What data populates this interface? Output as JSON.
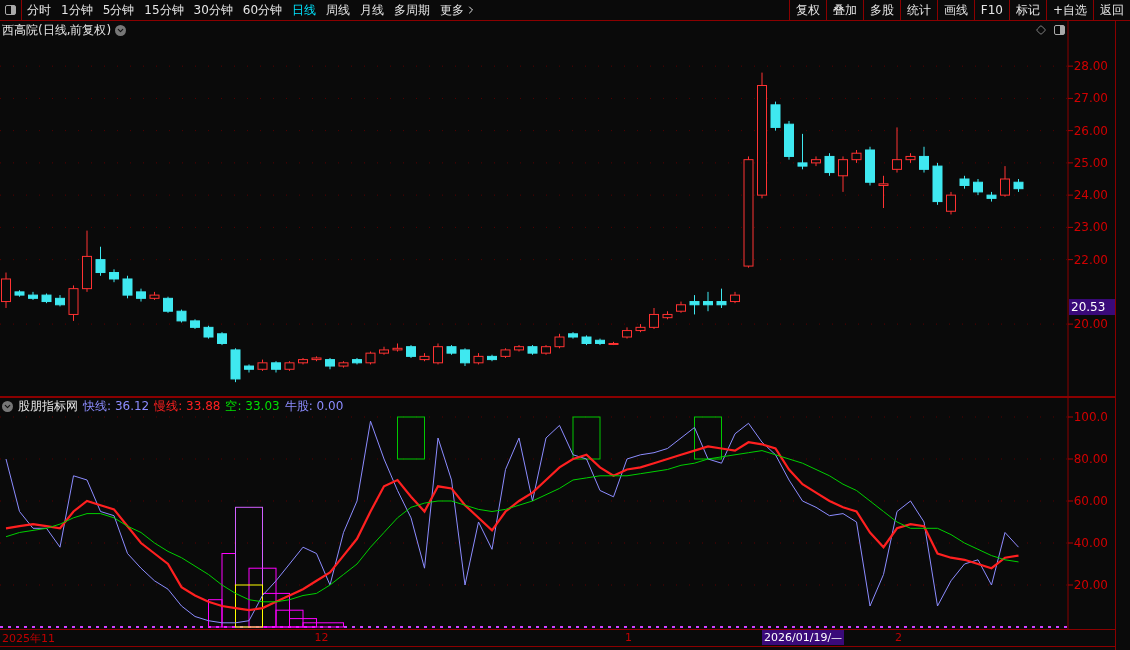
{
  "toolbar": {
    "periods": [
      {
        "label": "分时",
        "selected": false
      },
      {
        "label": "1分钟",
        "selected": false
      },
      {
        "label": "5分钟",
        "selected": false
      },
      {
        "label": "15分钟",
        "selected": false
      },
      {
        "label": "30分钟",
        "selected": false
      },
      {
        "label": "60分钟",
        "selected": false
      },
      {
        "label": "日线",
        "selected": true
      },
      {
        "label": "周线",
        "selected": false
      },
      {
        "label": "月线",
        "selected": false
      },
      {
        "label": "多周期",
        "selected": false
      },
      {
        "label": "更多",
        "selected": false
      }
    ],
    "actions": [
      "复权",
      "叠加",
      "多股",
      "统计",
      "画线",
      "F10",
      "标记",
      "+自选",
      "返回"
    ]
  },
  "price_panel": {
    "title": "西高院(日线,前复权)",
    "last_price": "20.53",
    "chart_data": {
      "type": "candlestick",
      "grid": true,
      "ylim": [
        17.74,
        29.4
      ],
      "yticks": [
        {
          "value": 28,
          "label": "28.00"
        },
        {
          "value": 27,
          "label": "27.00"
        },
        {
          "value": 26,
          "label": "26.00"
        },
        {
          "value": 25,
          "label": "25.00"
        },
        {
          "value": 24,
          "label": "24.00"
        },
        {
          "value": 23,
          "label": "23.00"
        },
        {
          "value": 22,
          "label": "22.00"
        },
        {
          "value": 20,
          "label": "20.00"
        }
      ],
      "ohlc": [
        [
          20.7,
          21.6,
          20.5,
          21.4
        ],
        [
          21.0,
          21.05,
          20.85,
          20.9
        ],
        [
          20.9,
          21.0,
          20.75,
          20.8
        ],
        [
          20.9,
          20.95,
          20.65,
          20.7
        ],
        [
          20.8,
          20.9,
          20.55,
          20.6
        ],
        [
          20.3,
          21.2,
          20.1,
          21.1
        ],
        [
          21.1,
          22.9,
          21.0,
          22.1
        ],
        [
          22.0,
          22.4,
          21.5,
          21.6
        ],
        [
          21.6,
          21.7,
          21.3,
          21.4
        ],
        [
          21.4,
          21.5,
          20.8,
          20.9
        ],
        [
          21.0,
          21.1,
          20.7,
          20.8
        ],
        [
          20.8,
          21.0,
          20.75,
          20.9
        ],
        [
          20.8,
          20.85,
          20.35,
          20.4
        ],
        [
          20.4,
          20.45,
          20.05,
          20.1
        ],
        [
          20.1,
          20.15,
          19.85,
          19.9
        ],
        [
          19.9,
          19.95,
          19.55,
          19.6
        ],
        [
          19.7,
          19.75,
          19.35,
          19.4
        ],
        [
          19.2,
          19.25,
          18.2,
          18.3
        ],
        [
          18.7,
          18.75,
          18.5,
          18.6
        ],
        [
          18.6,
          18.9,
          18.55,
          18.8
        ],
        [
          18.8,
          18.85,
          18.5,
          18.6
        ],
        [
          18.6,
          18.85,
          18.55,
          18.8
        ],
        [
          18.8,
          18.95,
          18.75,
          18.9
        ],
        [
          18.9,
          19.0,
          18.85,
          18.95
        ],
        [
          18.9,
          18.95,
          18.6,
          18.7
        ],
        [
          18.7,
          18.85,
          18.65,
          18.8
        ],
        [
          18.9,
          18.95,
          18.75,
          18.8
        ],
        [
          18.8,
          19.15,
          18.75,
          19.1
        ],
        [
          19.1,
          19.3,
          19.05,
          19.2
        ],
        [
          19.2,
          19.4,
          19.15,
          19.25
        ],
        [
          19.3,
          19.35,
          18.95,
          19.0
        ],
        [
          18.9,
          19.1,
          18.85,
          19.0
        ],
        [
          18.8,
          19.4,
          18.75,
          19.3
        ],
        [
          19.3,
          19.35,
          19.05,
          19.1
        ],
        [
          19.2,
          19.25,
          18.7,
          18.8
        ],
        [
          18.8,
          19.1,
          18.75,
          19.0
        ],
        [
          19.0,
          19.05,
          18.85,
          18.9
        ],
        [
          19.0,
          19.25,
          18.95,
          19.2
        ],
        [
          19.2,
          19.35,
          19.15,
          19.3
        ],
        [
          19.3,
          19.35,
          19.05,
          19.1
        ],
        [
          19.1,
          19.35,
          19.05,
          19.3
        ],
        [
          19.3,
          19.7,
          19.25,
          19.6
        ],
        [
          19.7,
          19.75,
          19.55,
          19.6
        ],
        [
          19.6,
          19.65,
          19.35,
          19.4
        ],
        [
          19.5,
          19.55,
          19.35,
          19.4
        ],
        [
          19.4,
          19.45,
          19.35,
          19.4
        ],
        [
          19.6,
          19.9,
          19.55,
          19.8
        ],
        [
          19.8,
          20.0,
          19.75,
          19.9
        ],
        [
          19.9,
          20.5,
          19.85,
          20.3
        ],
        [
          20.2,
          20.4,
          20.15,
          20.3
        ],
        [
          20.4,
          20.7,
          20.35,
          20.6
        ],
        [
          20.7,
          20.9,
          20.3,
          20.6
        ],
        [
          20.7,
          21.0,
          20.4,
          20.6
        ],
        [
          20.7,
          21.1,
          20.5,
          20.6
        ],
        [
          20.7,
          21.0,
          20.65,
          20.9
        ],
        [
          21.8,
          25.2,
          21.75,
          25.1
        ],
        [
          24.0,
          27.8,
          23.9,
          27.4
        ],
        [
          26.8,
          26.9,
          26.0,
          26.1
        ],
        [
          26.2,
          26.3,
          25.1,
          25.2
        ],
        [
          25.0,
          25.9,
          24.8,
          24.9
        ],
        [
          25.0,
          25.2,
          24.9,
          25.1
        ],
        [
          25.2,
          25.3,
          24.6,
          24.7
        ],
        [
          24.6,
          25.2,
          24.1,
          25.1
        ],
        [
          25.1,
          25.4,
          25.0,
          25.3
        ],
        [
          25.4,
          25.5,
          24.3,
          24.4
        ],
        [
          24.3,
          24.6,
          23.6,
          24.35
        ],
        [
          24.8,
          26.1,
          24.7,
          25.1
        ],
        [
          25.1,
          25.3,
          25.0,
          25.2
        ],
        [
          25.2,
          25.5,
          24.7,
          24.8
        ],
        [
          24.9,
          25.0,
          23.7,
          23.8
        ],
        [
          23.5,
          24.1,
          23.4,
          24.0
        ],
        [
          24.5,
          24.6,
          24.2,
          24.3
        ],
        [
          24.4,
          24.5,
          24.0,
          24.1
        ],
        [
          24.0,
          24.1,
          23.8,
          23.9
        ],
        [
          24.0,
          24.9,
          23.95,
          24.5
        ],
        [
          24.4,
          24.5,
          24.1,
          24.2
        ]
      ]
    }
  },
  "indicator_panel": {
    "name": "股朋指标网",
    "readouts": [
      {
        "label": "快线:",
        "value": "36.12",
        "color": "#8c8cff"
      },
      {
        "label": "慢线:",
        "value": "33.88",
        "color": "#ff2020"
      },
      {
        "label": "空:",
        "value": "33.03",
        "color": "#00e000"
      },
      {
        "label": "牛股:",
        "value": "0.00",
        "color": "#8c8cff"
      }
    ],
    "chart_data": {
      "type": "line",
      "grid": true,
      "ylim": [
        -0.95,
        109.52
      ],
      "yticks": [
        {
          "value": 100,
          "label": "100.0"
        },
        {
          "value": 80,
          "label": "80.00"
        },
        {
          "value": 60,
          "label": "60.00"
        },
        {
          "value": 40,
          "label": "40.00"
        },
        {
          "value": 20,
          "label": "20.00"
        }
      ],
      "series": [
        {
          "color": "#8c8cff",
          "values": [
            80,
            55,
            47,
            47,
            38,
            72,
            70,
            55,
            53,
            35,
            28,
            22,
            18,
            10,
            5,
            3,
            2,
            2,
            3,
            15,
            22,
            30,
            38,
            35,
            20,
            45,
            60,
            98,
            80,
            65,
            52,
            28,
            90,
            70,
            20,
            50,
            37,
            75,
            90,
            60,
            90,
            96,
            82,
            80,
            65,
            62,
            80,
            82,
            83,
            85,
            90,
            95,
            80,
            78,
            92,
            97,
            88,
            82,
            70,
            60,
            57,
            53,
            54,
            50,
            10,
            25,
            55,
            60,
            50,
            10,
            22,
            30,
            32,
            20,
            45,
            38
          ]
        },
        {
          "color": "#ff2020",
          "values": [
            47,
            48,
            49,
            48,
            47,
            55,
            60,
            58,
            56,
            48,
            40,
            35,
            30,
            19,
            15,
            12,
            10,
            9,
            8,
            9,
            12,
            15,
            18,
            22,
            26,
            34,
            42,
            55,
            67,
            70,
            62,
            55,
            67,
            66,
            58,
            52,
            46,
            55,
            60,
            64,
            70,
            76,
            80,
            82,
            76,
            72,
            75,
            76,
            78,
            80,
            82,
            84,
            86,
            85,
            84,
            88,
            87,
            85,
            75,
            68,
            64,
            60,
            57,
            55,
            45,
            38,
            47,
            49,
            48,
            35,
            33,
            32,
            30,
            28,
            33,
            34
          ]
        },
        {
          "color": "#00d000",
          "values": [
            43,
            45,
            46,
            47,
            49,
            52,
            54,
            54,
            52,
            48,
            45,
            40,
            36,
            33,
            29,
            25,
            20,
            16,
            13,
            12,
            12,
            13,
            15,
            16,
            20,
            25,
            30,
            38,
            45,
            52,
            57,
            59,
            60,
            60,
            58,
            56,
            55,
            56,
            58,
            60,
            63,
            66,
            70,
            71,
            72,
            72,
            72,
            73,
            74,
            75,
            77,
            78,
            80,
            81,
            82,
            83,
            84,
            82,
            80,
            78,
            75,
            72,
            68,
            65,
            60,
            55,
            50,
            47,
            47,
            47,
            44,
            40,
            37,
            34,
            32,
            31
          ]
        }
      ]
    }
  },
  "time_axis": {
    "labels": [
      "2025年11",
      "12",
      "1",
      "2"
    ],
    "cursor": "2026/01/19/—"
  }
}
